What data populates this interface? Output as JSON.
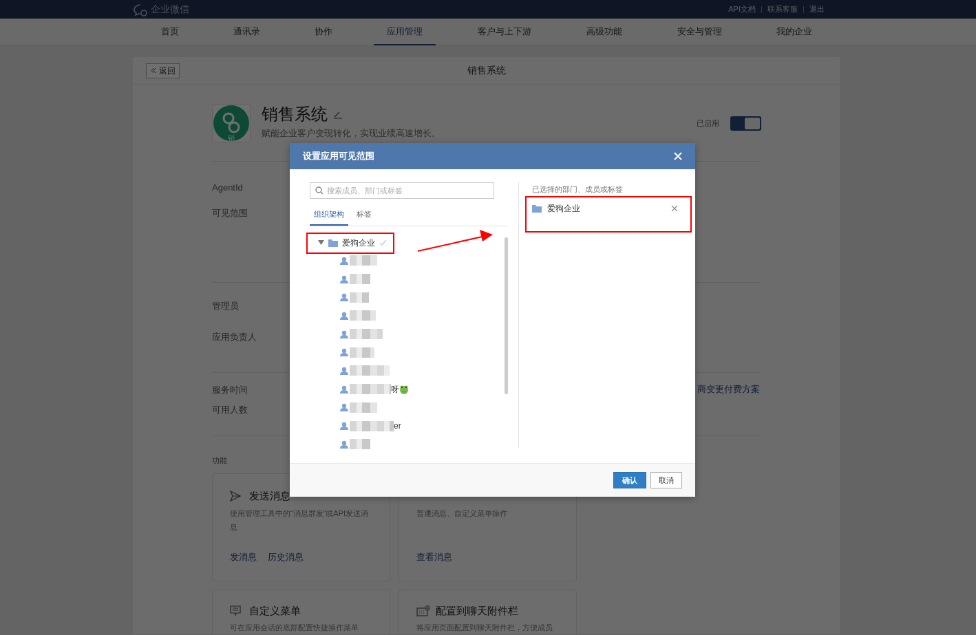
{
  "topbar": {
    "logo_text": "企业微信",
    "links": [
      "API文档",
      "联系客服",
      "退出"
    ]
  },
  "nav": [
    {
      "label": "首页",
      "selected": false
    },
    {
      "label": "通讯录",
      "selected": false
    },
    {
      "label": "协作",
      "selected": false
    },
    {
      "label": "应用管理",
      "selected": true
    },
    {
      "label": "客户与上下游",
      "selected": false
    },
    {
      "label": "高级功能",
      "selected": false
    },
    {
      "label": "安全与管理",
      "selected": false
    },
    {
      "label": "我的企业",
      "selected": false
    }
  ],
  "page": {
    "back": "返回",
    "title": "销售系统"
  },
  "app": {
    "name": "销售系统",
    "description": "赋能企业客户变现转化，实现业绩高速增长。",
    "icon_text": "销",
    "status_label": "已启用",
    "enabled": true
  },
  "settings_groups": [
    [
      "AgentId",
      "可见范围"
    ],
    [
      "管理员",
      "应用负责人"
    ],
    [
      "服务时间",
      "可用人数"
    ]
  ],
  "service_link_fragment": "商变更付费方案",
  "features": {
    "heading": "功能",
    "cards": [
      {
        "kind": "send",
        "title": "发送消息",
        "description": "使用管理工具中的“消息群发”或API发送消息",
        "links": [
          "发消息",
          "历史消息"
        ]
      },
      {
        "kind": "covered",
        "description": "普通消息、自定义菜单操作",
        "links": [
          "查看消息"
        ]
      },
      {
        "kind": "menu",
        "title": "自定义菜单",
        "description": "可在应用会话的底部配置快捷操作菜单"
      },
      {
        "kind": "attach",
        "title": "配置到聊天附件栏",
        "description": "将应用页面配置到聊天附件栏，方便成员"
      }
    ]
  },
  "dialog": {
    "title": "设置应用可见范围",
    "search": {
      "placeholder": "搜索成员、部门或标签"
    },
    "tabs": [
      {
        "label": "组织架构",
        "selected": true
      },
      {
        "label": "标签",
        "selected": false
      }
    ],
    "tree": [
      {
        "label": "爱狗企业",
        "expanded": true,
        "checked": true,
        "children": [
          {
            "kind": "member"
          },
          {
            "kind": "member"
          },
          {
            "kind": "member"
          },
          {
            "kind": "member"
          },
          {
            "kind": "member"
          },
          {
            "kind": "member"
          },
          {
            "kind": "member"
          },
          {
            "kind": "member",
            "suffix": "呀",
            "emoji": true
          },
          {
            "kind": "member"
          },
          {
            "kind": "member",
            "suffix": "er"
          },
          {
            "kind": "member"
          }
        ]
      }
    ],
    "selected_heading": "已选择的部门、成员或标签",
    "selected_items": [
      {
        "label": "爱狗企业"
      }
    ],
    "buttons": [
      {
        "label": "确认",
        "kind": "primary"
      },
      {
        "label": "取消",
        "kind": "secondary"
      }
    ]
  }
}
